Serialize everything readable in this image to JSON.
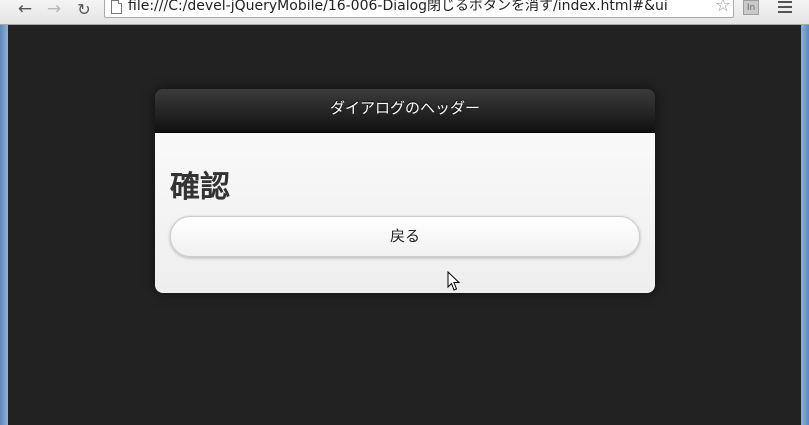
{
  "browser": {
    "url": "file:///C:/devel-jQueryMobile/16-006-Dialog閉じるボタンを消す/index.html#&ui",
    "nav": {
      "back_icon": "back-arrow-icon",
      "forward_icon": "forward-arrow-icon",
      "reload_icon": "reload-icon"
    },
    "extension_label": "In",
    "star_icon": "bookmark-star-icon",
    "menu_icon": "hamburger-menu-icon"
  },
  "dialog": {
    "header_title": "ダイアログのヘッダー",
    "content_title": "確認",
    "back_button_label": "戻る"
  },
  "colors": {
    "page_background": "#222222",
    "header_background": "#1a1a1a",
    "content_background": "#f4f4f4",
    "window_frame": "#6e98c6"
  }
}
